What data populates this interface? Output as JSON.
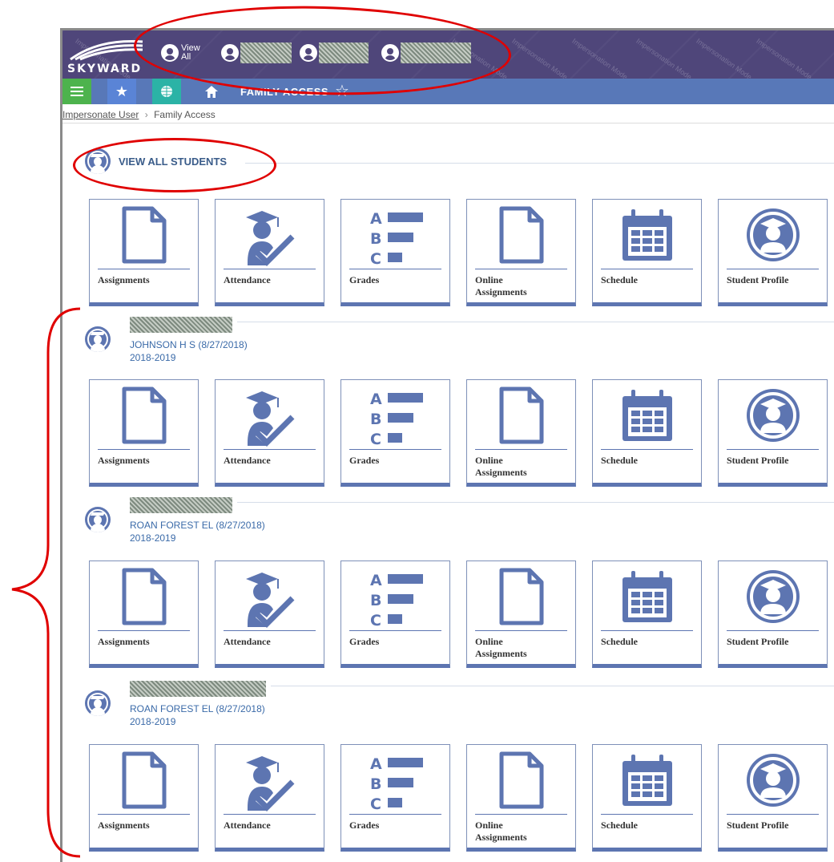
{
  "app": {
    "logo": "SKYWARD",
    "watermark": "Impersonation Mode"
  },
  "header": {
    "view_all_label": "View All",
    "student_switchers": [
      "redacted-1",
      "redacted-2",
      "redacted-3"
    ]
  },
  "navbar": {
    "buttons": [
      "menu-icon",
      "favorites-star-icon",
      "globe-icon",
      "home-icon"
    ],
    "title": "FAMILY ACCESS",
    "colors": {
      "menu": "#4db34d",
      "favorites": "#5a84d6",
      "globe": "#2bb3a6",
      "bar": "#5878b8"
    }
  },
  "breadcrumb": {
    "link": "Impersonate User",
    "separator": "›",
    "current": "Family Access"
  },
  "view_all": {
    "title": "VIEW ALL STUDENTS"
  },
  "tiles": [
    {
      "icon": "document-icon",
      "label": "Assignments"
    },
    {
      "icon": "attendance-icon",
      "label": "Attendance"
    },
    {
      "icon": "grades-icon",
      "label": "Grades"
    },
    {
      "icon": "document-icon",
      "label": "Online Assignments"
    },
    {
      "icon": "calendar-icon",
      "label": "Schedule"
    },
    {
      "icon": "student-profile-icon",
      "label": "Student Profile"
    }
  ],
  "students": [
    {
      "school": "JOHNSON H S (8/27/2018)",
      "year": "2018-2019"
    },
    {
      "school": "ROAN FOREST EL (8/27/2018)",
      "year": "2018-2019"
    },
    {
      "school": "ROAN FOREST EL (8/27/2018)",
      "year": "2018-2019"
    }
  ],
  "annotation_color": "#e00000"
}
